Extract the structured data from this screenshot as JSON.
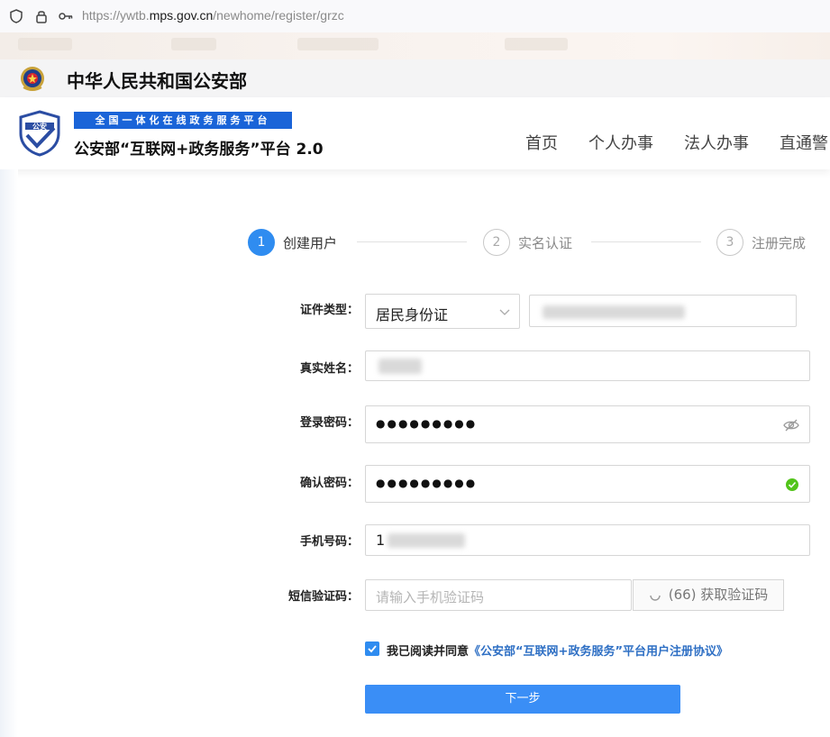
{
  "browser": {
    "url_prefix": "https://ywtb.",
    "url_domain": "mps.gov.cn",
    "url_path": "/newhome/register/grzc"
  },
  "ministry": {
    "title": "中华人民共和国公安部"
  },
  "header": {
    "banner": "全国一体化在线政务服务平台",
    "platform_title": "公安部“互联网+政务服务”平台 2.0",
    "logo_text": "公安",
    "nav": [
      "首页",
      "个人办事",
      "法人办事",
      "直通警"
    ]
  },
  "steps": [
    {
      "num": "1",
      "label": "创建用户",
      "active": true
    },
    {
      "num": "2",
      "label": "实名认证",
      "active": false
    },
    {
      "num": "3",
      "label": "注册完成",
      "active": false
    }
  ],
  "form": {
    "id_type_label": "证件类型：",
    "id_type_value": "居民身份证",
    "name_label": "真实姓名：",
    "password_label": "登录密码：",
    "password_value": "●●●●●●●●●",
    "confirm_label": "确认密码：",
    "confirm_value": "●●●●●●●●●",
    "phone_label": "手机号码：",
    "phone_prefix": "1",
    "sms_label": "短信验证码：",
    "sms_placeholder": "请输入手机验证码",
    "sms_button": "(66) 获取验证码",
    "agree_text": "我已阅读并同意",
    "agree_link": "《公安部“互联网+政务服务”平台用户注册协议》",
    "next_button": "下一步"
  },
  "colors": {
    "accent": "#2f8cf0",
    "banner": "#1a64d8",
    "success": "#52c41a"
  }
}
